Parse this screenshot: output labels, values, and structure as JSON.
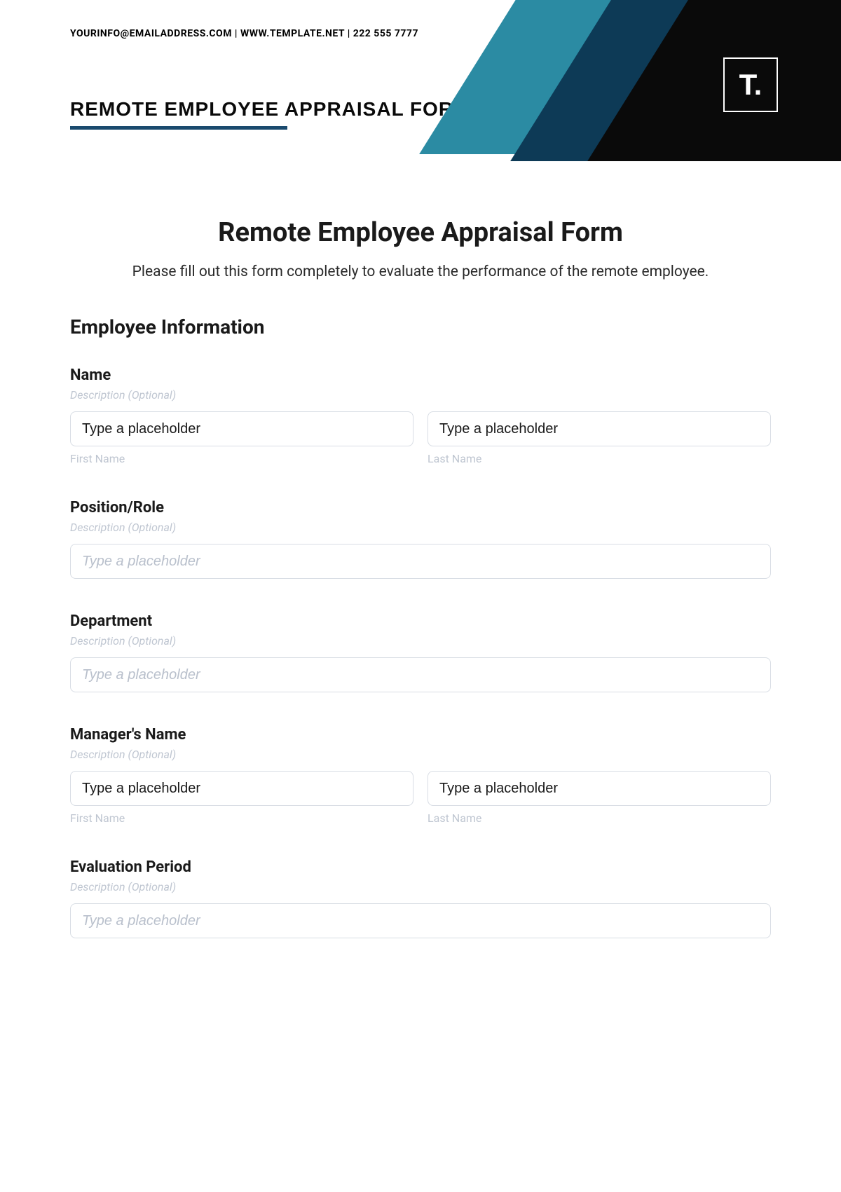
{
  "header": {
    "contact_line": "YOURINFO@EMAILADDRESS.COM  |  WWW.TEMPLATE.NET  |  222 555 7777",
    "title": "REMOTE EMPLOYEE APPRAISAL FORM",
    "logo_text": "T."
  },
  "form": {
    "title": "Remote Employee Appraisal Form",
    "intro": "Please fill out this form completely to evaluate the performance of the remote employee.",
    "section_heading": "Employee Information",
    "desc_optional": "Description (Optional)",
    "placeholder_dark": "Type a placeholder",
    "placeholder_light": "Type a placeholder",
    "sub_first": "First Name",
    "sub_last": "Last Name",
    "fields": {
      "name": {
        "label": "Name"
      },
      "position": {
        "label": "Position/Role"
      },
      "department": {
        "label": "Department"
      },
      "manager": {
        "label": "Manager's Name"
      },
      "evaluation": {
        "label": "Evaluation Period"
      }
    }
  }
}
